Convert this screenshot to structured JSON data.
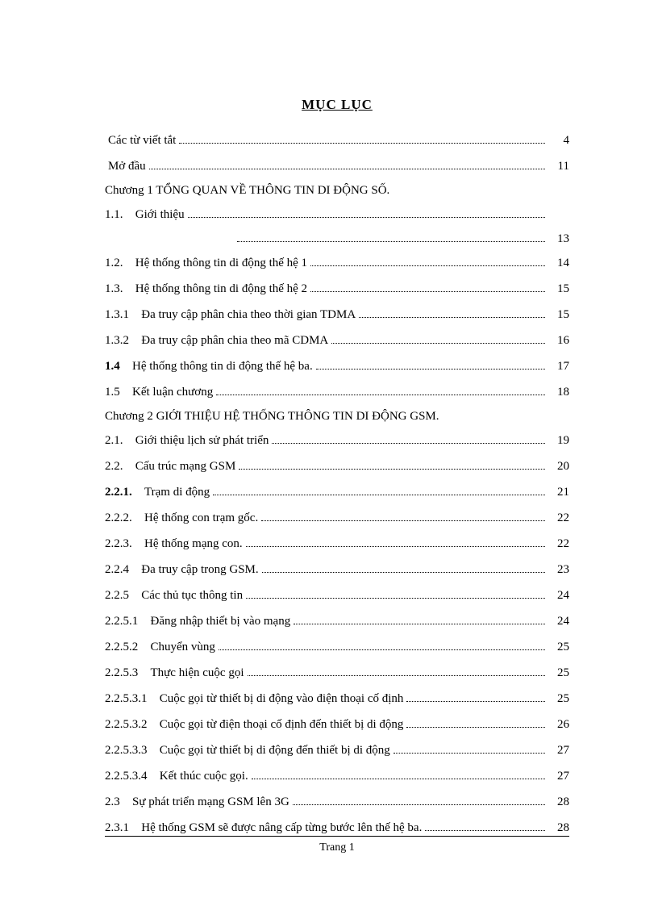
{
  "title": "MỤC LỤC",
  "entries": [
    {
      "type": "leaf",
      "num": "",
      "text": "Các từ viết tắt",
      "page": "4"
    },
    {
      "type": "leaf",
      "num": "",
      "text": "Mở đầu",
      "page": "11"
    },
    {
      "type": "chapter",
      "text": "Chương 1  TỔNG QUAN VỀ THÔNG TIN DI ĐỘNG  SỐ."
    },
    {
      "type": "leaf_nopg",
      "num": "1.1.",
      "text": "Giới thiệu"
    },
    {
      "type": "cont",
      "page": "13"
    },
    {
      "type": "leaf",
      "num": "1.2.",
      "text": "Hệ thống thông tin di động  thế hệ 1",
      "page": "14"
    },
    {
      "type": "leaf",
      "num": "1.3.",
      "text": "Hệ thống thông tin di động  thế hệ 2",
      "page": "15"
    },
    {
      "type": "leaf",
      "num": "1.3.1",
      "text": "Đa truy cập  phân  chia theo  thời  gian TDMA",
      "page": "15"
    },
    {
      "type": "leaf",
      "num": "1.3.2",
      "text": "Đa truy cập  phân  chia theo  mã  CDMA",
      "page": "16"
    },
    {
      "type": "leaf",
      "num": "1.4",
      "numBold": true,
      "text": "Hệ thống thông tin di động thế hệ ba.",
      "page": "17"
    },
    {
      "type": "leaf",
      "num": "1.5",
      "text": "Kết luận chương",
      "page": "18"
    },
    {
      "type": "chapter",
      "text": "Chương 2  GIỚI THIỆU HỆ THỐNG THÔNG TIN DI ĐỘNG GSM."
    },
    {
      "type": "leaf",
      "num": "2.1.",
      "text": "Giới thiệu lịch sử phát triển",
      "page": "19"
    },
    {
      "type": "leaf",
      "num": "2.2.",
      "text": "Cấu trúc mạng GSM",
      "page": "20"
    },
    {
      "type": "leaf",
      "num": "2.2.1.",
      "numBold": true,
      "text": "Trạm di động",
      "page": "21"
    },
    {
      "type": "leaf",
      "num": "2.2.2.",
      "text": "Hệ thống con trạm gốc.",
      "page": "22"
    },
    {
      "type": "leaf",
      "num": "2.2.3.",
      "text": "Hệ thống mạng  con.",
      "page": "22"
    },
    {
      "type": "leaf",
      "num": "2.2.4",
      "text": "Đa truy cập trong GSM.",
      "page": "23"
    },
    {
      "type": "leaf",
      "num": "2.2.5",
      "text": "Các thủ tục thông tin",
      "page": "24"
    },
    {
      "type": "leaf",
      "num": "2.2.5.1",
      "text": "Đăng nhập thiết bị vào mạng",
      "page": "24"
    },
    {
      "type": "leaf",
      "num": "2.2.5.2",
      "text": "Chuyển vùng",
      "page": "25"
    },
    {
      "type": "leaf",
      "num": "2.2.5.3",
      "text": "Thực hiện cuộc gọi",
      "page": "25"
    },
    {
      "type": "leaf",
      "num": "2.2.5.3.1",
      "text": "Cuộc gọi từ thiết bị di động vào điện thoại cố định",
      "page": "25"
    },
    {
      "type": "leaf",
      "num": "2.2.5.3.2",
      "text": "Cuộc gọi từ điện thoại cố định đến thiết bị di động",
      "page": "26"
    },
    {
      "type": "leaf",
      "num": "2.2.5.3.3",
      "text": "Cuộc gọi từ thiết bị di động đến thiết bị di động",
      "page": "27"
    },
    {
      "type": "leaf",
      "num": "2.2.5.3.4",
      "text": "Kết thúc cuộc gọi.",
      "page": "27"
    },
    {
      "type": "leaf",
      "num": "2.3",
      "text": "Sự phát triển mạng  GSM lên 3G",
      "page": "28"
    },
    {
      "type": "leaf",
      "num": "2.3.1",
      "text": "Hệ thống GSM sẽ được nâng cấp từng bước lên thế hệ ba.",
      "page": "28"
    }
  ],
  "footer": "Trang  1"
}
